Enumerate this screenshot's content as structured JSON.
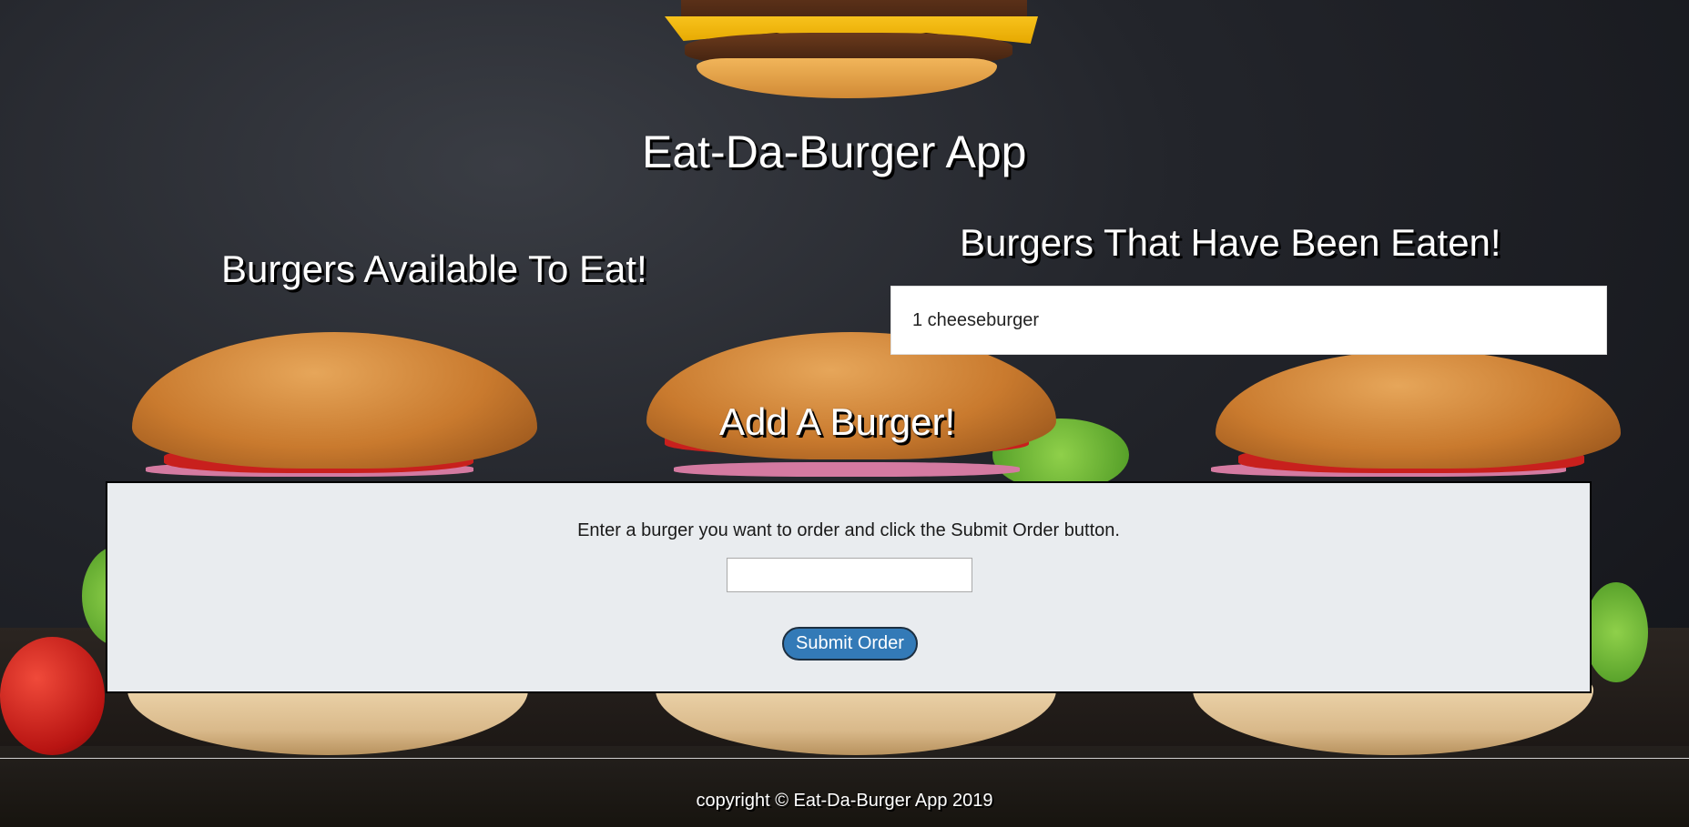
{
  "header": {
    "title": "Eat-Da-Burger App"
  },
  "available": {
    "heading": "Burgers Available To Eat!",
    "items": []
  },
  "eaten": {
    "heading": "Burgers That Have Been Eaten!",
    "items": [
      {
        "label": "1 cheeseburger"
      }
    ]
  },
  "add_burger": {
    "heading": "Add A Burger!",
    "instructions": "Enter a burger you want to order and click the Submit Order button.",
    "input_value": "",
    "input_placeholder": "",
    "submit_label": "Submit Order"
  },
  "footer": {
    "copyright": "copyright © Eat-Da-Burger App 2019"
  },
  "colors": {
    "submit_button": "#337ab7",
    "panel_background": "#e9ecef",
    "heading_text": "#ffffff",
    "heading_shadow": "#000000"
  },
  "icons": {
    "logo": "burger-logo-icon",
    "background": "burger-background-image"
  }
}
